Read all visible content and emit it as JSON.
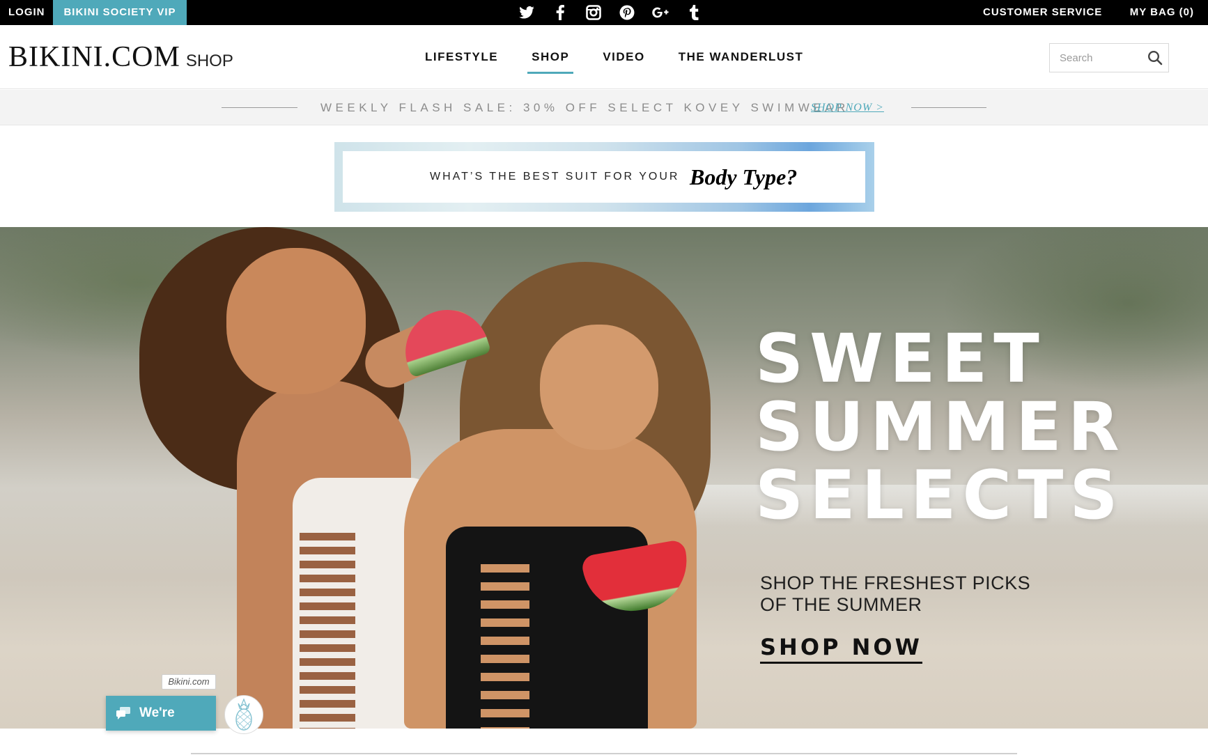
{
  "topbar": {
    "login": "LOGIN",
    "vip": "BIKINI SOCIETY VIP",
    "social_icons": [
      "twitter-icon",
      "facebook-icon",
      "instagram-icon",
      "pinterest-icon",
      "google-plus-icon",
      "tumblr-icon"
    ],
    "customer_service": "CUSTOMER SERVICE",
    "bag": "MY BAG (0)"
  },
  "header": {
    "logo_main": "BIKINI.COM",
    "logo_sub": "SHOP",
    "nav": [
      {
        "label": "LIFESTYLE",
        "active": false
      },
      {
        "label": "SHOP",
        "active": true
      },
      {
        "label": "VIDEO",
        "active": false
      },
      {
        "label": "THE WANDERLUST",
        "active": false
      }
    ],
    "search_placeholder": "Search"
  },
  "flash": {
    "text": "WEEKLY FLASH SALE: 30% OFF SELECT KOVEY SWIMWEAR",
    "link": "SHOP NOW >"
  },
  "body_type_banner": {
    "lead": "WHAT’S THE BEST SUIT FOR YOUR",
    "script": "Body Type?"
  },
  "hero": {
    "title_lines": [
      "SWEET",
      "SUMMER",
      "SELECTS"
    ],
    "subtitle_line1": "SHOP THE FRESHEST PICKS",
    "subtitle_line2": "OF THE SUMMER",
    "cta": "SHOP NOW"
  },
  "chat": {
    "brand_tag": "Bikini.com",
    "status": "We're offline"
  },
  "colors": {
    "accent": "#4fa9ba",
    "topbar_bg": "#000000",
    "flash_bg": "#f3f3f3"
  }
}
